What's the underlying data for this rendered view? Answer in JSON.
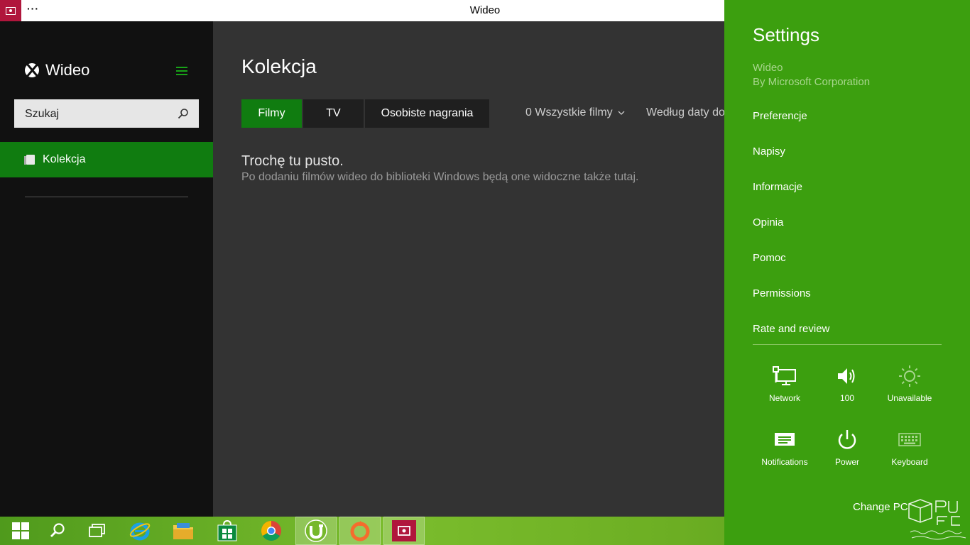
{
  "window": {
    "title": "Wideo",
    "menu_dots": "···"
  },
  "sidebar": {
    "app_name": "Wideo",
    "search": {
      "placeholder": "Szukaj"
    },
    "items": [
      {
        "label": "Kolekcja",
        "active": true
      }
    ]
  },
  "main": {
    "heading": "Kolekcja",
    "tabs": [
      {
        "label": "Filmy",
        "active": true
      },
      {
        "label": "TV",
        "active": false
      },
      {
        "label": "Osobiste nagrania",
        "active": false
      }
    ],
    "filter": "0 Wszystkie filmy",
    "sort": "Według daty do",
    "empty_title": "Trochę tu pusto.",
    "empty_desc": "Po dodaniu filmów wideo do biblioteki Windows będą one widoczne także tutaj."
  },
  "charm": {
    "title": "Settings",
    "app": "Wideo",
    "publisher": "By Microsoft Corporation",
    "items": [
      "Preferencje",
      "Napisy",
      "Informacje",
      "Opinia",
      "Pomoc",
      "Permissions",
      "Rate and review"
    ],
    "quick_settings": {
      "network": "Network",
      "volume": "100",
      "brightness": "Unavailable",
      "notifications": "Notifications",
      "power": "Power",
      "keyboard": "Keyboard"
    },
    "change_pc": "Change PC"
  },
  "taskbar": {
    "icons": [
      "start-icon",
      "search-icon",
      "task-view-icon",
      "internet-explorer-icon",
      "file-explorer-icon",
      "store-icon",
      "chrome-icon",
      "utorrent-icon",
      "origin-icon",
      "video-app-icon"
    ]
  },
  "colors": {
    "accent": "#107c10",
    "charm_bg": "#3c9f0f",
    "title_icon": "#b0163c",
    "sidebar_bg": "#111111",
    "main_bg": "#333333"
  }
}
